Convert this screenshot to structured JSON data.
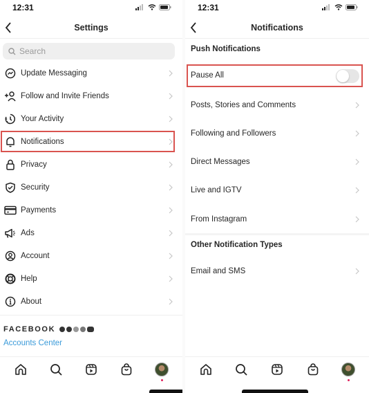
{
  "left": {
    "status": {
      "time": "12:31"
    },
    "title": "Settings",
    "search": {
      "placeholder": "Search"
    },
    "items": [
      {
        "label": "Update Messaging",
        "icon": "messenger-icon"
      },
      {
        "label": "Follow and Invite Friends",
        "icon": "add-person-icon"
      },
      {
        "label": "Your Activity",
        "icon": "activity-clock-icon"
      },
      {
        "label": "Notifications",
        "icon": "bell-icon",
        "highlighted": true
      },
      {
        "label": "Privacy",
        "icon": "lock-icon"
      },
      {
        "label": "Security",
        "icon": "shield-check-icon"
      },
      {
        "label": "Payments",
        "icon": "credit-card-icon"
      },
      {
        "label": "Ads",
        "icon": "megaphone-icon"
      },
      {
        "label": "Account",
        "icon": "person-circle-icon"
      },
      {
        "label": "Help",
        "icon": "lifebuoy-icon"
      },
      {
        "label": "About",
        "icon": "info-icon"
      }
    ],
    "facebook": {
      "wordmark": "FACEBOOK",
      "link": "Accounts Center"
    }
  },
  "right": {
    "status": {
      "time": "12:31"
    },
    "title": "Notifications",
    "push_section": "Push Notifications",
    "pause_all": {
      "label": "Pause All",
      "on": false
    },
    "items": [
      {
        "label": "Posts, Stories and Comments"
      },
      {
        "label": "Following and Followers"
      },
      {
        "label": "Direct Messages"
      },
      {
        "label": "Live and IGTV"
      },
      {
        "label": "From Instagram"
      }
    ],
    "other_section": "Other Notification Types",
    "other_items": [
      {
        "label": "Email and SMS"
      }
    ]
  },
  "tabbar": [
    "home-icon",
    "search-icon",
    "reels-icon",
    "shop-icon",
    "profile-avatar"
  ],
  "colors": {
    "highlight": "#d9534f",
    "link": "#3a9ad9"
  }
}
